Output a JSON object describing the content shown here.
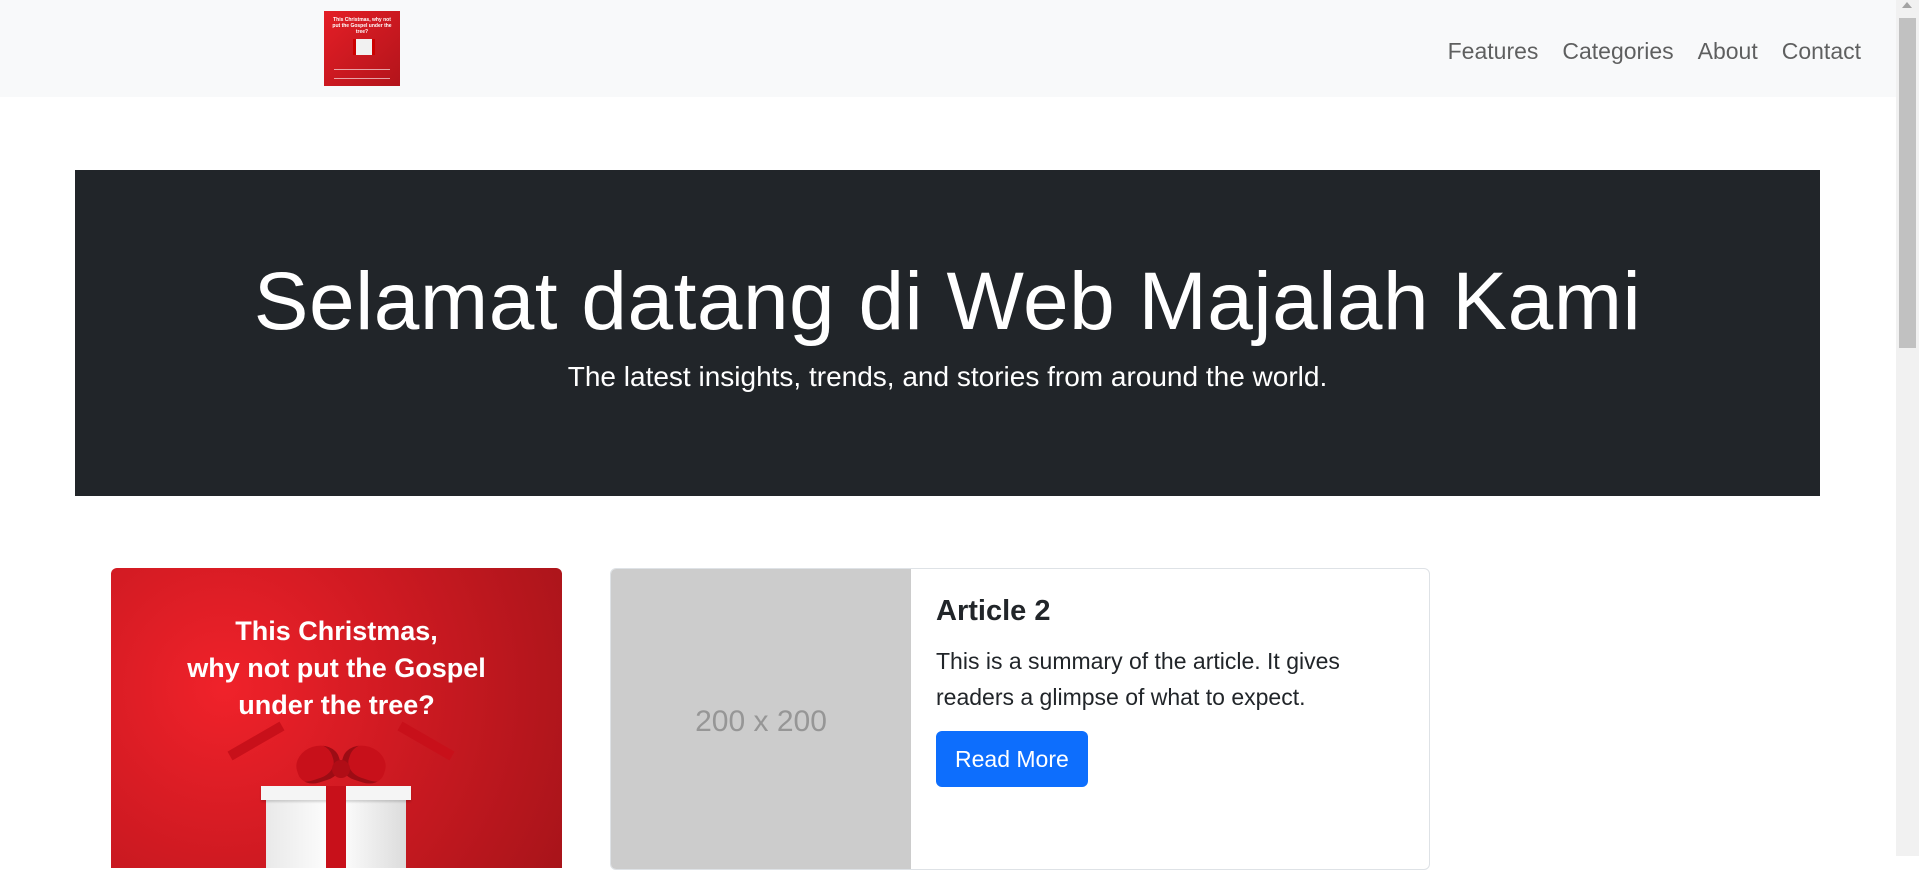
{
  "navbar": {
    "logo": {
      "text": "This Christmas, why not put the Gospel under the tree?"
    },
    "links": [
      "Features",
      "Categories",
      "About",
      "Contact"
    ]
  },
  "hero": {
    "title": "Selamat datang di Web Majalah Kami",
    "subtitle": "The latest insights, trends, and stories from around the world."
  },
  "cards": {
    "card1": {
      "image_text": "This Christmas, why not put the Gospel under the tree?",
      "image_line1": "This Christmas,",
      "image_line2": "why not put the Gospel",
      "image_line3": "under the tree?"
    },
    "card2": {
      "placeholder": "200 x 200",
      "title": "Article 2",
      "text": "This is a summary of the article. It gives readers a glimpse of what to expect.",
      "button": "Read More"
    }
  },
  "colors": {
    "navbar_bg": "#f8f9fa",
    "hero_bg": "#212529",
    "primary": "#0d6efd",
    "card_red": "#e41e26"
  }
}
